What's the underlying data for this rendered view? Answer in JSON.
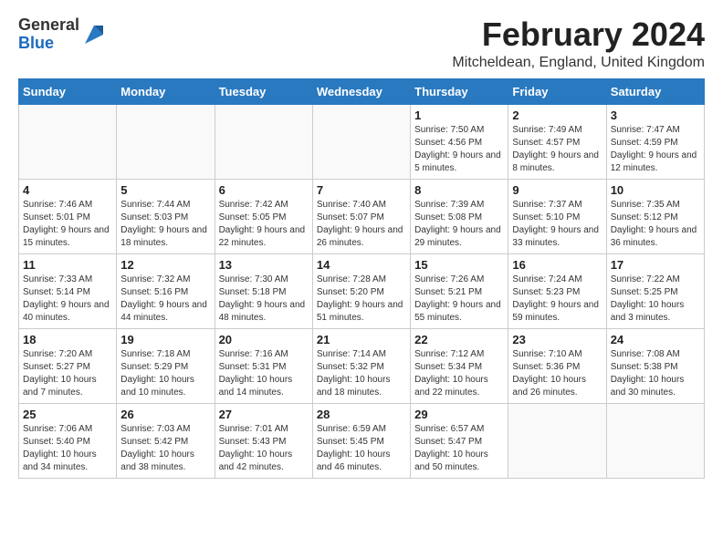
{
  "header": {
    "logo_line1": "General",
    "logo_line2": "Blue",
    "main_title": "February 2024",
    "subtitle": "Mitcheldean, England, United Kingdom"
  },
  "calendar": {
    "days_of_week": [
      "Sunday",
      "Monday",
      "Tuesday",
      "Wednesday",
      "Thursday",
      "Friday",
      "Saturday"
    ],
    "weeks": [
      [
        {
          "day": "",
          "info": ""
        },
        {
          "day": "",
          "info": ""
        },
        {
          "day": "",
          "info": ""
        },
        {
          "day": "",
          "info": ""
        },
        {
          "day": "1",
          "info": "Sunrise: 7:50 AM\nSunset: 4:56 PM\nDaylight: 9 hours\nand 5 minutes."
        },
        {
          "day": "2",
          "info": "Sunrise: 7:49 AM\nSunset: 4:57 PM\nDaylight: 9 hours\nand 8 minutes."
        },
        {
          "day": "3",
          "info": "Sunrise: 7:47 AM\nSunset: 4:59 PM\nDaylight: 9 hours\nand 12 minutes."
        }
      ],
      [
        {
          "day": "4",
          "info": "Sunrise: 7:46 AM\nSunset: 5:01 PM\nDaylight: 9 hours\nand 15 minutes."
        },
        {
          "day": "5",
          "info": "Sunrise: 7:44 AM\nSunset: 5:03 PM\nDaylight: 9 hours\nand 18 minutes."
        },
        {
          "day": "6",
          "info": "Sunrise: 7:42 AM\nSunset: 5:05 PM\nDaylight: 9 hours\nand 22 minutes."
        },
        {
          "day": "7",
          "info": "Sunrise: 7:40 AM\nSunset: 5:07 PM\nDaylight: 9 hours\nand 26 minutes."
        },
        {
          "day": "8",
          "info": "Sunrise: 7:39 AM\nSunset: 5:08 PM\nDaylight: 9 hours\nand 29 minutes."
        },
        {
          "day": "9",
          "info": "Sunrise: 7:37 AM\nSunset: 5:10 PM\nDaylight: 9 hours\nand 33 minutes."
        },
        {
          "day": "10",
          "info": "Sunrise: 7:35 AM\nSunset: 5:12 PM\nDaylight: 9 hours\nand 36 minutes."
        }
      ],
      [
        {
          "day": "11",
          "info": "Sunrise: 7:33 AM\nSunset: 5:14 PM\nDaylight: 9 hours\nand 40 minutes."
        },
        {
          "day": "12",
          "info": "Sunrise: 7:32 AM\nSunset: 5:16 PM\nDaylight: 9 hours\nand 44 minutes."
        },
        {
          "day": "13",
          "info": "Sunrise: 7:30 AM\nSunset: 5:18 PM\nDaylight: 9 hours\nand 48 minutes."
        },
        {
          "day": "14",
          "info": "Sunrise: 7:28 AM\nSunset: 5:20 PM\nDaylight: 9 hours\nand 51 minutes."
        },
        {
          "day": "15",
          "info": "Sunrise: 7:26 AM\nSunset: 5:21 PM\nDaylight: 9 hours\nand 55 minutes."
        },
        {
          "day": "16",
          "info": "Sunrise: 7:24 AM\nSunset: 5:23 PM\nDaylight: 9 hours\nand 59 minutes."
        },
        {
          "day": "17",
          "info": "Sunrise: 7:22 AM\nSunset: 5:25 PM\nDaylight: 10 hours\nand 3 minutes."
        }
      ],
      [
        {
          "day": "18",
          "info": "Sunrise: 7:20 AM\nSunset: 5:27 PM\nDaylight: 10 hours\nand 7 minutes."
        },
        {
          "day": "19",
          "info": "Sunrise: 7:18 AM\nSunset: 5:29 PM\nDaylight: 10 hours\nand 10 minutes."
        },
        {
          "day": "20",
          "info": "Sunrise: 7:16 AM\nSunset: 5:31 PM\nDaylight: 10 hours\nand 14 minutes."
        },
        {
          "day": "21",
          "info": "Sunrise: 7:14 AM\nSunset: 5:32 PM\nDaylight: 10 hours\nand 18 minutes."
        },
        {
          "day": "22",
          "info": "Sunrise: 7:12 AM\nSunset: 5:34 PM\nDaylight: 10 hours\nand 22 minutes."
        },
        {
          "day": "23",
          "info": "Sunrise: 7:10 AM\nSunset: 5:36 PM\nDaylight: 10 hours\nand 26 minutes."
        },
        {
          "day": "24",
          "info": "Sunrise: 7:08 AM\nSunset: 5:38 PM\nDaylight: 10 hours\nand 30 minutes."
        }
      ],
      [
        {
          "day": "25",
          "info": "Sunrise: 7:06 AM\nSunset: 5:40 PM\nDaylight: 10 hours\nand 34 minutes."
        },
        {
          "day": "26",
          "info": "Sunrise: 7:03 AM\nSunset: 5:42 PM\nDaylight: 10 hours\nand 38 minutes."
        },
        {
          "day": "27",
          "info": "Sunrise: 7:01 AM\nSunset: 5:43 PM\nDaylight: 10 hours\nand 42 minutes."
        },
        {
          "day": "28",
          "info": "Sunrise: 6:59 AM\nSunset: 5:45 PM\nDaylight: 10 hours\nand 46 minutes."
        },
        {
          "day": "29",
          "info": "Sunrise: 6:57 AM\nSunset: 5:47 PM\nDaylight: 10 hours\nand 50 minutes."
        },
        {
          "day": "",
          "info": ""
        },
        {
          "day": "",
          "info": ""
        }
      ]
    ]
  }
}
